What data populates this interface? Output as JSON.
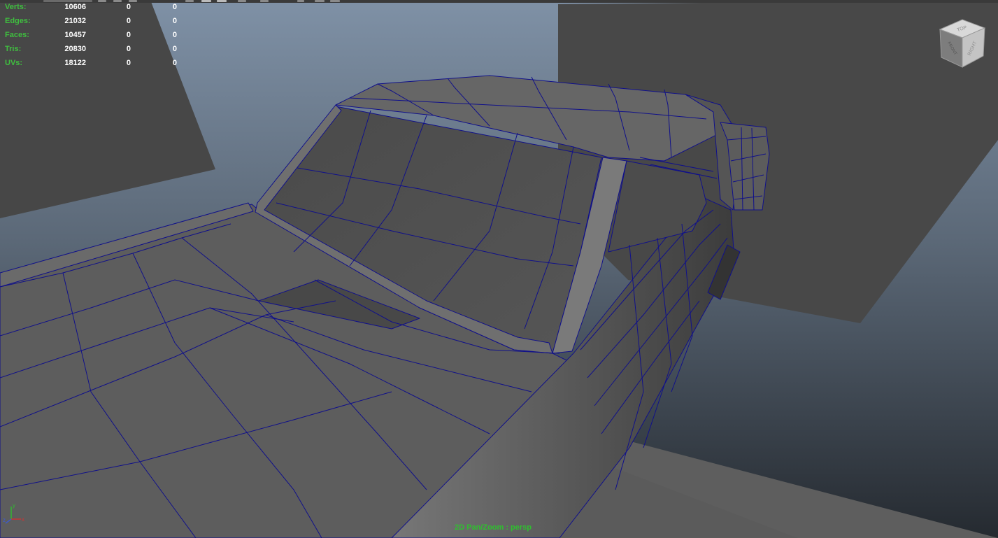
{
  "hud": {
    "rows": [
      {
        "label": "Verts:",
        "total": "10606",
        "selected": "0",
        "component": "0"
      },
      {
        "label": "Edges:",
        "total": "21032",
        "selected": "0",
        "component": "0"
      },
      {
        "label": "Faces:",
        "total": "10457",
        "selected": "0",
        "component": "0"
      },
      {
        "label": "Tris:",
        "total": "20830",
        "selected": "0",
        "component": "0"
      },
      {
        "label": "UVs:",
        "total": "18122",
        "selected": "0",
        "component": "0"
      }
    ]
  },
  "camera_label": "2D Pan/Zoom : persp",
  "view_cube": {
    "top_label": "TOP",
    "front_label": "FRONT",
    "right_label": "RIGHT"
  },
  "axis": {
    "x_label": "x",
    "y_label": "y",
    "z_label": "z"
  },
  "colors": {
    "wireframe": "#0f0f8c",
    "hud_label": "#3fbf3f",
    "hud_value": "#ffffff",
    "camera_label": "#2fbf2f",
    "background_top": "#7f91a6",
    "background_bottom": "#262b31"
  }
}
